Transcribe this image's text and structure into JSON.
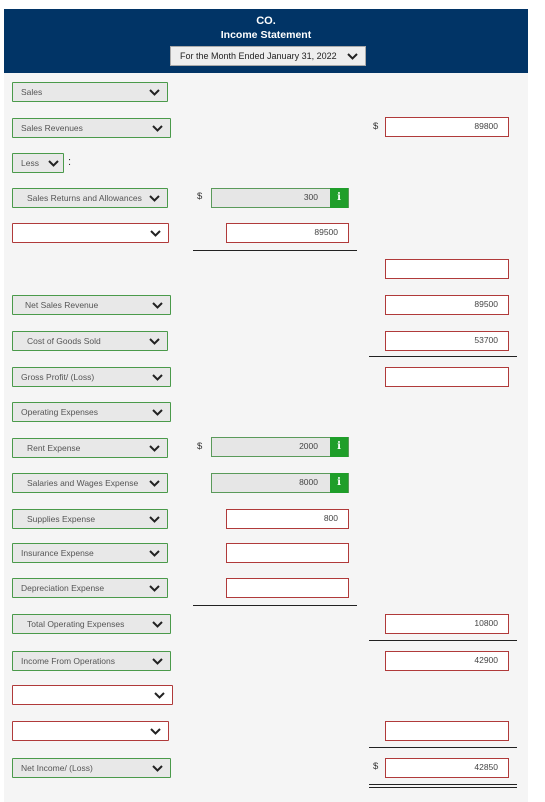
{
  "header": {
    "company": "CO.",
    "statement": "Income Statement",
    "period": "For the Month Ended January 31, 2022"
  },
  "rows": {
    "sales": {
      "label": "Sales"
    },
    "sales_revenues": {
      "label": "Sales Revenues",
      "currency": "$",
      "value": "89800"
    },
    "less": {
      "label": "Less",
      "colon": ":"
    },
    "returns": {
      "label": "Sales Returns and Allowances",
      "currency": "$",
      "value": "300"
    },
    "blank1": {
      "label": "",
      "value": "89500"
    },
    "col3_blank": {
      "value": ""
    },
    "net_sales": {
      "label": "Net Sales Revenue",
      "value": "89500"
    },
    "cogs": {
      "label": "Cost of Goods Sold",
      "value": "53700"
    },
    "gross_profit": {
      "label": "Gross Profit/ (Loss)",
      "value": ""
    },
    "operating": {
      "label": "Operating Expenses"
    },
    "rent": {
      "label": "Rent Expense",
      "currency": "$",
      "value": "2000"
    },
    "salaries": {
      "label": "Salaries and Wages Expense",
      "value": "8000"
    },
    "supplies": {
      "label": "Supplies Expense",
      "value": "800"
    },
    "insurance": {
      "label": "Insurance Expense",
      "value": ""
    },
    "depreciation": {
      "label": "Depreciation Expense",
      "value": ""
    },
    "total_opex": {
      "label": "Total Operating Expenses",
      "value": "10800"
    },
    "income_ops": {
      "label": "Income From Operations",
      "value": "42900"
    },
    "blank2": {
      "label": ""
    },
    "blank3": {
      "label": "",
      "value": ""
    },
    "net_income": {
      "label": "Net Income/ (Loss)",
      "currency": "$",
      "value": "42850"
    }
  },
  "info_icon": "i",
  "colors": {
    "header": "#013466",
    "valid": "#4a9a4a",
    "invalid": "#b03a3a",
    "info": "#1f9e2a"
  }
}
